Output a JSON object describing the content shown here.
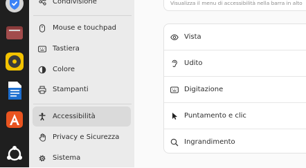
{
  "dock": {
    "items": [
      {
        "icon": "shield-app-icon",
        "color": "#3b82f6"
      },
      {
        "icon": "files-folder-icon",
        "color": "#8a3b3b"
      },
      {
        "icon": "rhythmbox-icon",
        "color": "#f2c200"
      },
      {
        "icon": "writer-document-icon",
        "color": "#1e6fd0"
      },
      {
        "icon": "app-center-icon",
        "color": "#e95420"
      },
      {
        "icon": "ubuntu-logo-icon",
        "color": "#ffffff"
      }
    ]
  },
  "sidebar": {
    "items": [
      {
        "label": "Condivisione",
        "icon": "share-icon"
      },
      {
        "label": "Mouse e touchpad",
        "icon": "mouse-icon"
      },
      {
        "label": "Tastiera",
        "icon": "keyboard-icon"
      },
      {
        "label": "Colore",
        "icon": "color-icon"
      },
      {
        "label": "Stampanti",
        "icon": "printer-icon"
      },
      {
        "label": "Accessibilità",
        "icon": "accessibility-icon",
        "active": true
      },
      {
        "label": "Privacy e Sicurezza",
        "icon": "hand-icon"
      },
      {
        "label": "Sistema",
        "icon": "system-gear-icon"
      }
    ]
  },
  "main": {
    "hint": "Visualizza il menu di accessibilità nella barra in alto",
    "rows": [
      {
        "label": "Vista",
        "icon": "eye-icon"
      },
      {
        "label": "Udito",
        "icon": "ear-icon"
      },
      {
        "label": "Digitazione",
        "icon": "keyboard-icon"
      },
      {
        "label": "Puntamento e clic",
        "icon": "pointer-icon"
      },
      {
        "label": "Ingrandimento",
        "icon": "magnifier-icon"
      }
    ]
  },
  "colors": {
    "accent": "#e95420",
    "sidebar_bg": "#ebebeb",
    "selected_bg": "#dadada"
  }
}
